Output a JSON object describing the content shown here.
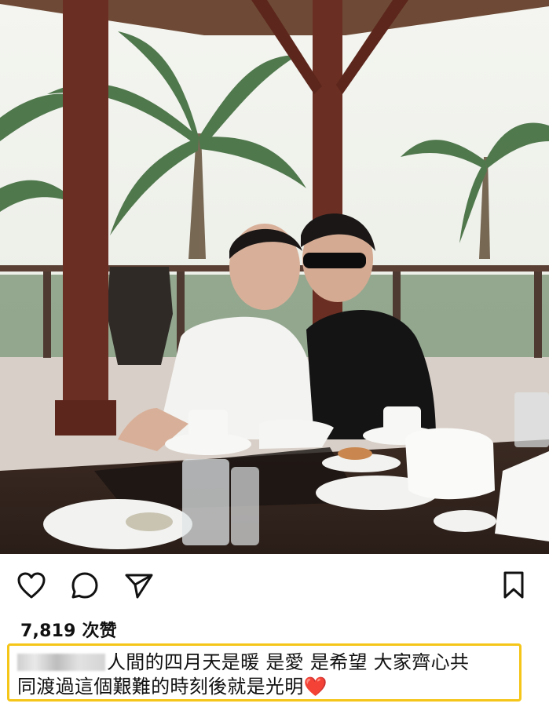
{
  "post": {
    "likes_text": "7,819 次赞",
    "caption_line1": "人間的四月天是暖 是愛 是希望 大家齊心共",
    "caption_line2": "同渡過這個艱難的時刻後就是光明",
    "caption_emoji": "❤️"
  },
  "icons": {
    "like": "heart-outline-icon",
    "comment": "comment-bubble-icon",
    "share": "paper-plane-icon",
    "save": "bookmark-icon"
  },
  "colors": {
    "caption_highlight": "#f5c518",
    "heart": "#e0245e"
  }
}
